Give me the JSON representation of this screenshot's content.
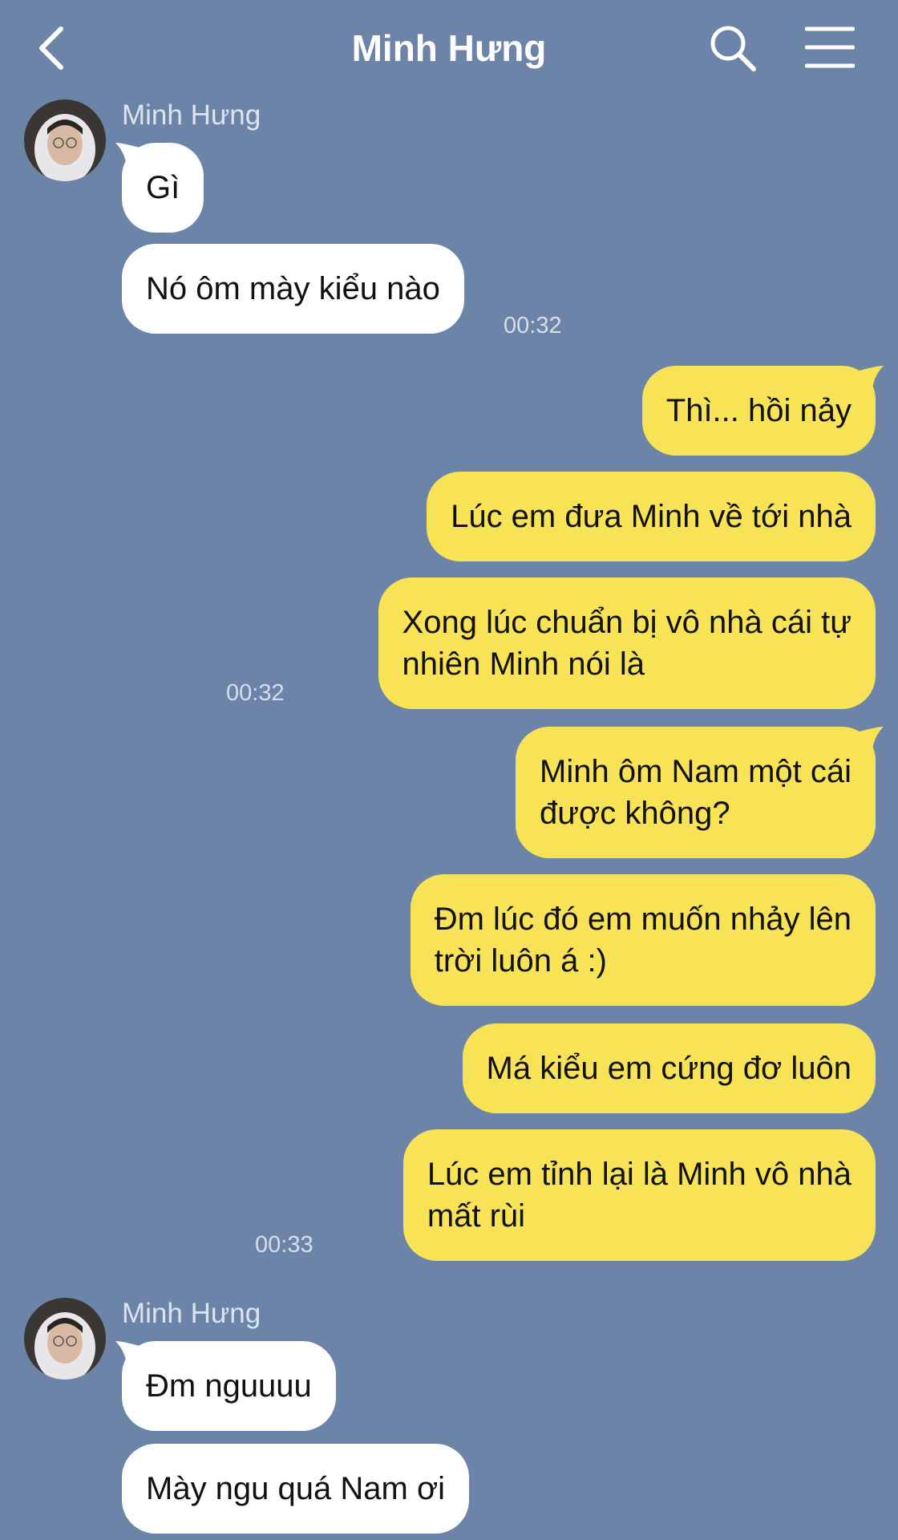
{
  "header": {
    "title": "Minh Hưng",
    "back_icon": "chevron-left-icon",
    "search_icon": "search-icon",
    "menu_icon": "hamburger-menu-icon"
  },
  "colors": {
    "background": "#6c84a8",
    "incoming_bubble": "#ffffff",
    "outgoing_bubble": "#f8e357"
  },
  "messages": [
    {
      "from": "Minh Hưng",
      "sender_label": "Minh Hưng",
      "text": "Gì"
    },
    {
      "from": "Minh Hưng",
      "text": "Nó ôm mày kiểu nào",
      "time": "00:32"
    },
    {
      "from": "me",
      "text": "Thì... hồi nảy"
    },
    {
      "from": "me",
      "text": "Lúc em đưa Minh về tới nhà"
    },
    {
      "from": "me",
      "text": "Xong lúc chuẩn bị vô nhà cái tự\nnhiên Minh nói là",
      "time": "00:32"
    },
    {
      "from": "me",
      "text": "Minh ôm Nam một cái\nđược không?"
    },
    {
      "from": "me",
      "text": "Đm lúc đó em muốn nhảy lên\ntrời luôn á :)"
    },
    {
      "from": "me",
      "text": "Má kiểu em cứng đơ luôn"
    },
    {
      "from": "me",
      "text": "Lúc em tỉnh lại là Minh vô nhà\nmất rùi",
      "time": "00:33"
    },
    {
      "from": "Minh Hưng",
      "sender_label": "Minh Hưng",
      "text": "Đm nguuuu"
    },
    {
      "from": "Minh Hưng",
      "text": "Mày ngu quá Nam ơi"
    }
  ]
}
